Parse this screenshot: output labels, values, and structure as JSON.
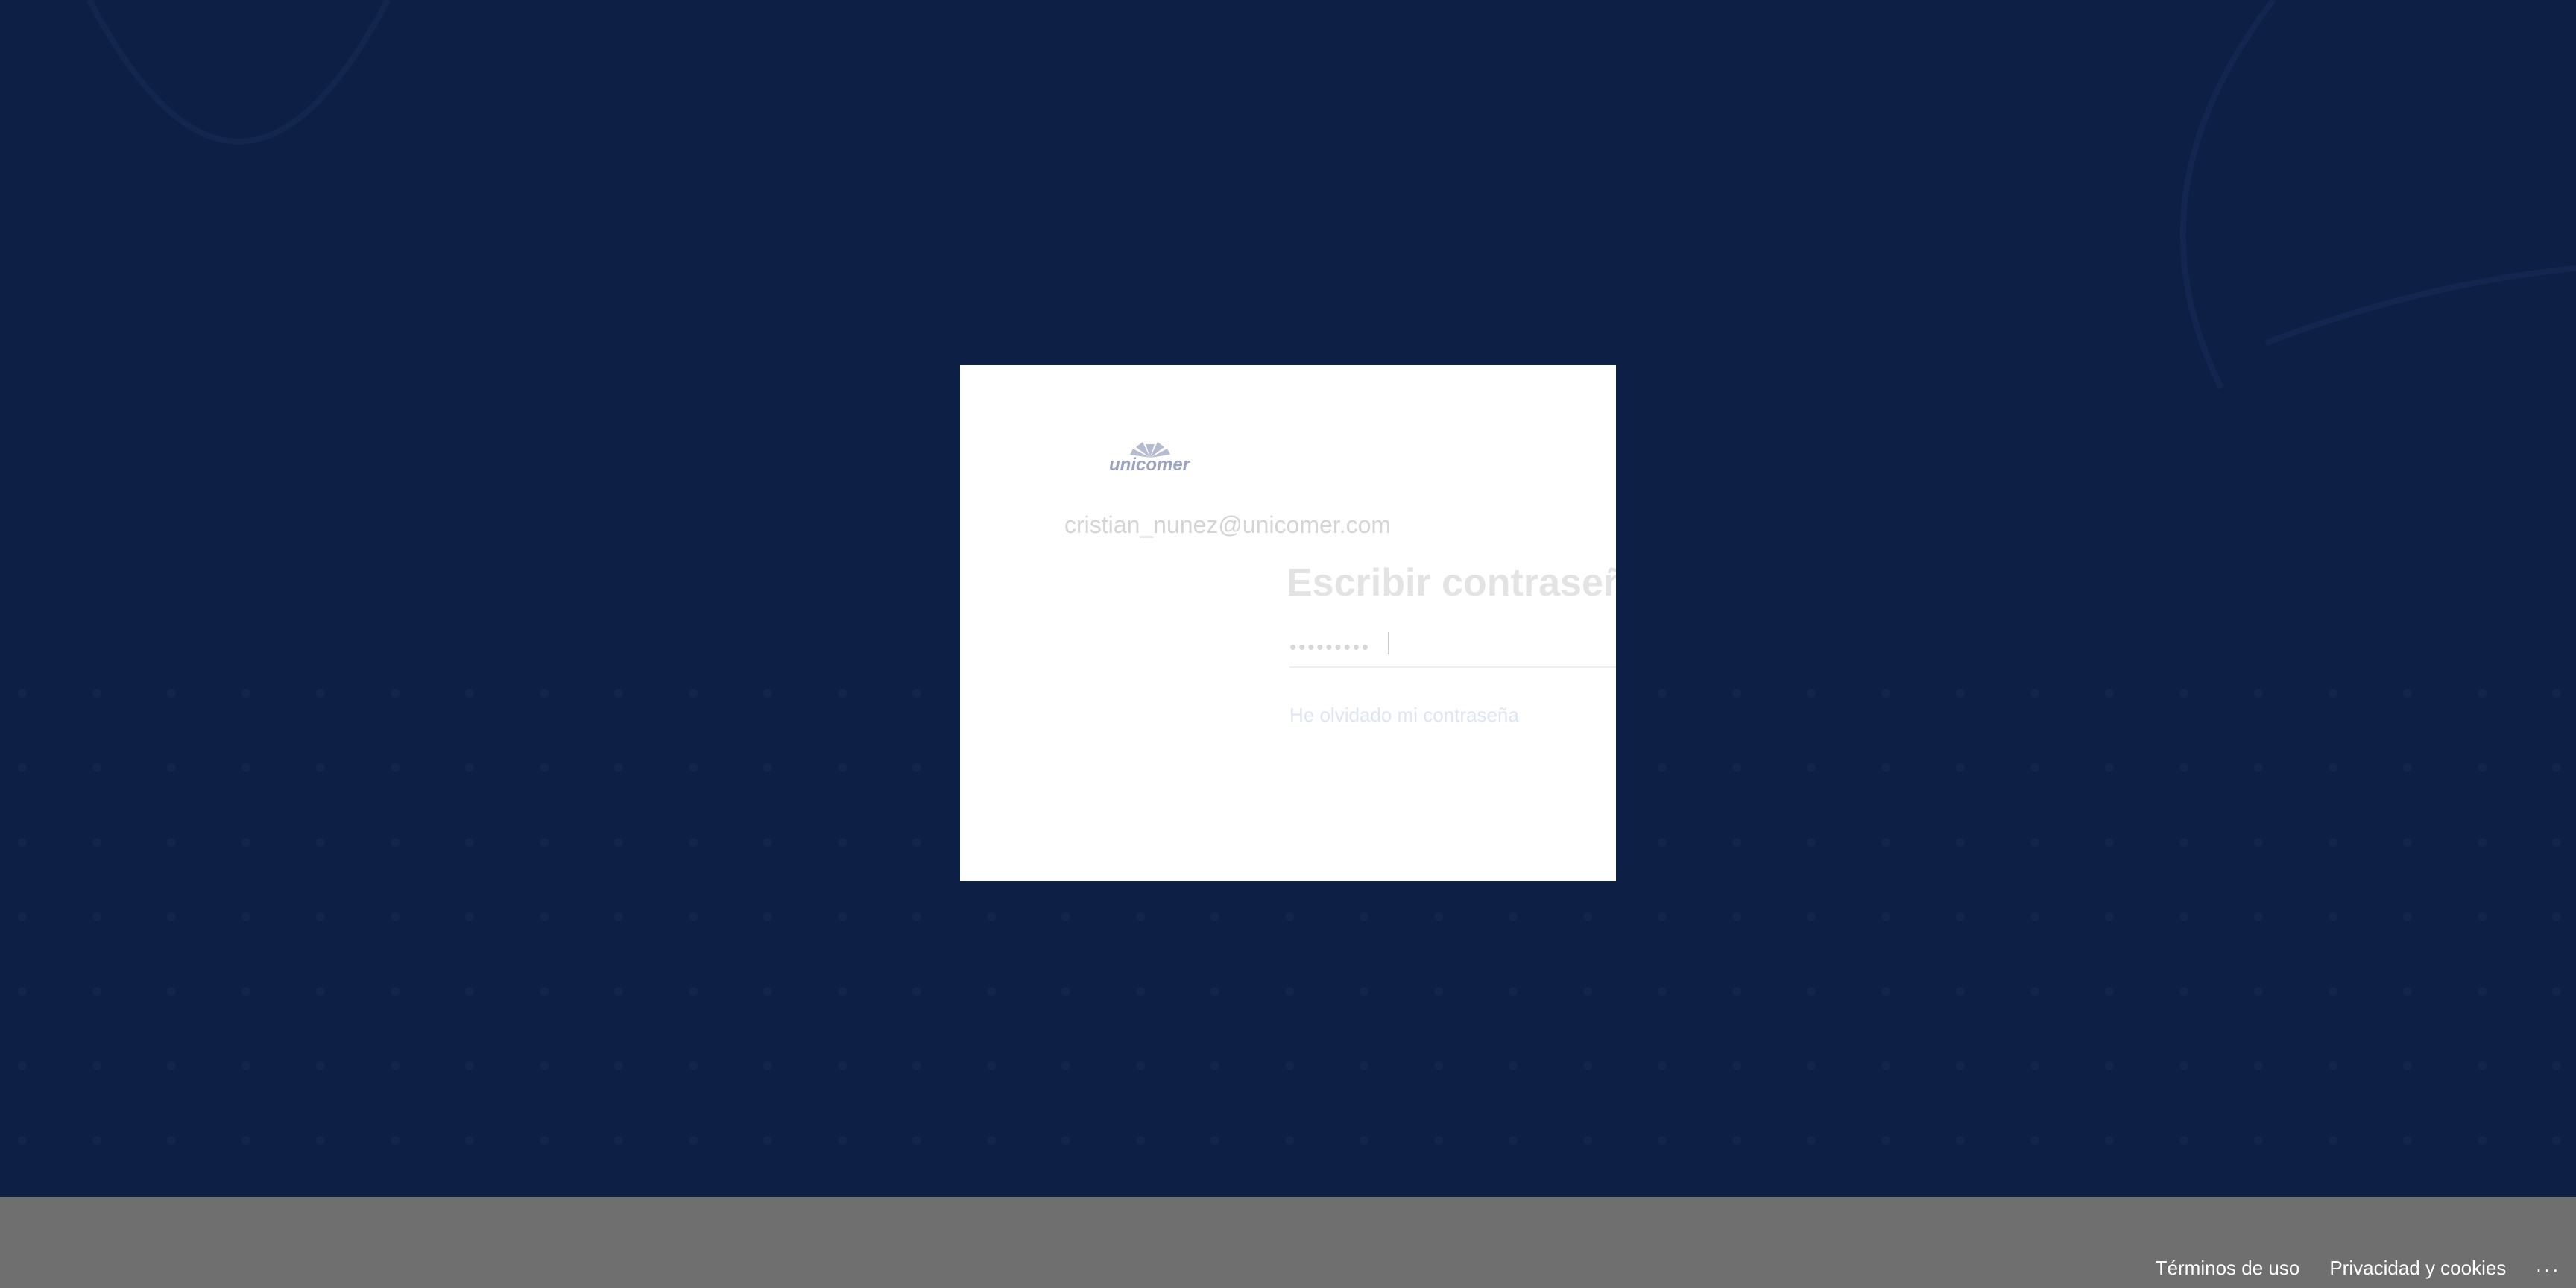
{
  "brand": {
    "logo_text": "unicomer",
    "logo_icon": "sun-rays-logo"
  },
  "signin": {
    "identity": "cristian_nunez@unicomer.com",
    "title": "Escribir contraseña",
    "password_value": "•••••••••",
    "forgot_link": "He olvidado mi contraseña"
  },
  "footer": {
    "terms_label": "Términos de uso",
    "privacy_label": "Privacidad y cookies",
    "more_label": "..."
  },
  "colors": {
    "background": "#0e1f45",
    "footer": "#6f6f6f",
    "card": "#ffffff"
  }
}
